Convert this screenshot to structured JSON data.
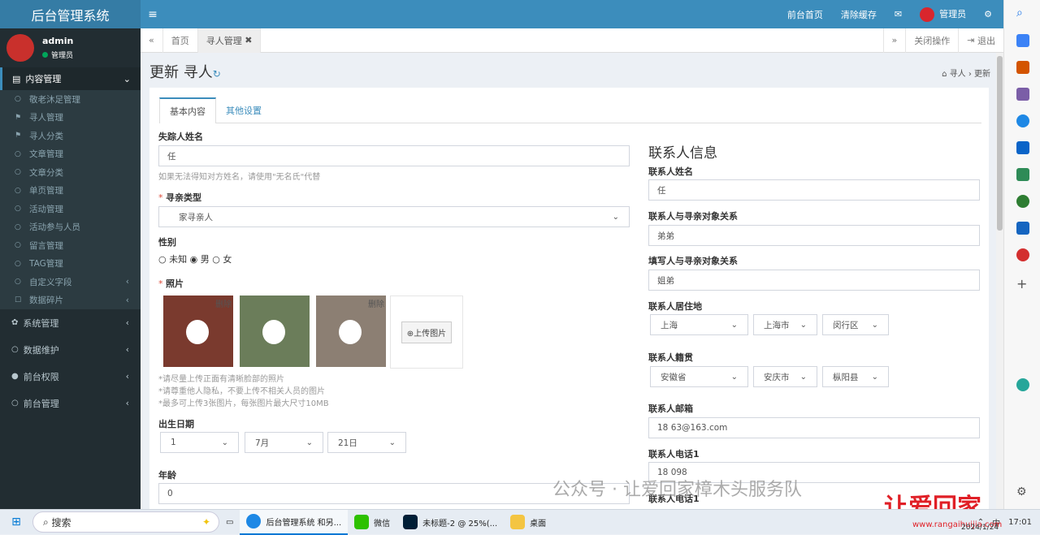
{
  "header": {
    "app_title": "后台管理系统",
    "menu_toggle": "≡",
    "links": [
      "前台首页",
      "清除缓存"
    ],
    "mail_icon": "✉",
    "user_label": "管理员",
    "settings_icon": "⚙"
  },
  "sidebar": {
    "user_name": "admin",
    "user_role": "管理员",
    "section": "内容管理",
    "sub_items": [
      {
        "icon": "○",
        "label": "敬老沐足管理"
      },
      {
        "icon": "⚑",
        "label": "寻人管理"
      },
      {
        "icon": "⚑",
        "label": "寻人分类"
      },
      {
        "icon": "○",
        "label": "文章管理"
      },
      {
        "icon": "○",
        "label": "文章分类"
      },
      {
        "icon": "○",
        "label": "单页管理"
      },
      {
        "icon": "○",
        "label": "活动管理"
      },
      {
        "icon": "○",
        "label": "活动参与人员"
      },
      {
        "icon": "○",
        "label": "留言管理"
      },
      {
        "icon": "○",
        "label": "TAG管理"
      },
      {
        "icon": "○",
        "label": "自定义字段",
        "arrow": "‹"
      },
      {
        "icon": "☐",
        "label": "数据碎片",
        "arrow": "‹"
      }
    ],
    "items": [
      {
        "icon": "✿",
        "label": "系统管理"
      },
      {
        "icon": "○",
        "label": "数据维护"
      },
      {
        "icon": "●",
        "label": "前台权限"
      },
      {
        "icon": "○",
        "label": "前台管理"
      }
    ]
  },
  "tabs": {
    "nav_left": "«",
    "home": "首页",
    "current": "寻人管理",
    "close": "✖",
    "nav_right": "»",
    "close_ops": "关闭操作",
    "logout": "退出"
  },
  "page": {
    "title": "更新 寻人",
    "refresh_icon": "↻",
    "breadcrumb": "寻人 › 更新"
  },
  "form": {
    "tabs": [
      "基本内容",
      "其他设置"
    ],
    "missing_name_label": "失踪人姓名",
    "missing_name_value": "任",
    "missing_name_help": "如果无法得知对方姓名，请使用\"无名氏\"代替",
    "search_type_label": "寻亲类型",
    "search_type_value": "家寻亲人",
    "gender_label": "性别",
    "gender_options": [
      "未知",
      "男",
      "女"
    ],
    "gender_selected": "男",
    "photo_label": "照片",
    "photo_delete": "删除",
    "upload_button": "上传图片",
    "photo_help": [
      "*请尽量上传正面有清晰脸部的照片",
      "*请尊重他人隐私，不要上传不相关人员的图片",
      "*最多可上传3张图片，每张图片最大尺寸10MB"
    ],
    "birth_label": "出生日期",
    "birth_year": "1",
    "birth_month": "7月",
    "birth_day": "21日",
    "age_label": "年龄",
    "age_value": "0"
  },
  "contact": {
    "title": "联系人信息",
    "name_label": "联系人姓名",
    "name_value": "任",
    "relation_label": "联系人与寻亲对象关系",
    "relation_value": "弟弟",
    "filler_relation_label": "填写人与寻亲对象关系",
    "filler_relation_value": "姐弟",
    "residence_label": "联系人居住地",
    "residence": [
      "上海",
      "上海市",
      "闵行区"
    ],
    "native_label": "联系人籍贯",
    "native": [
      "安徽省",
      "安庆市",
      "枞阳县"
    ],
    "email_label": "联系人邮箱",
    "email_value": "18        63@163.com",
    "phone1_label": "联系人电话1",
    "phone1_value": "18        098",
    "phone2_label": "联系人电话1"
  },
  "watermark": {
    "text": "公众号 · 让爱回家樟木头服务队",
    "logo": "让爱回家",
    "url": "www.rangaihuijia.com"
  },
  "taskbar": {
    "search_placeholder": "搜索",
    "apps": [
      "后台管理系统 和另...",
      "微信",
      "未标题-2 @ 25%(...",
      "桌面"
    ],
    "input_method": "中",
    "time": "17:01",
    "date": "2024/1/24"
  },
  "colors": {
    "sidebar_bg": "#222d32",
    "header_bg": "#3c8dbc",
    "accent": "#3c8dbc",
    "required": "#dd4b39"
  }
}
